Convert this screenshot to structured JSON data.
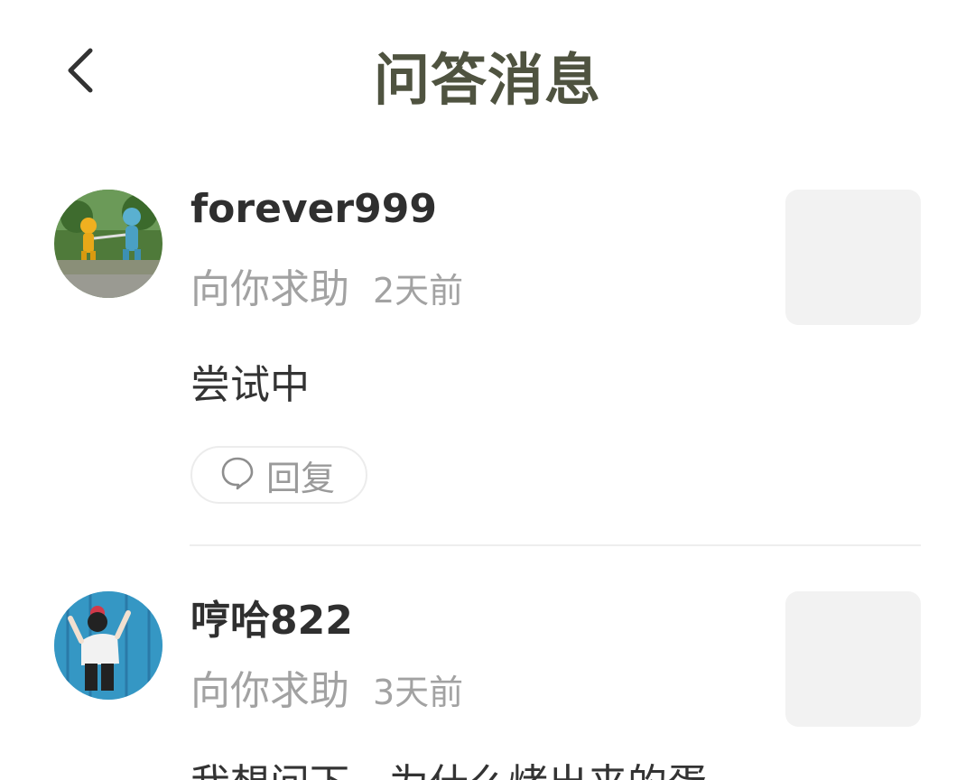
{
  "header": {
    "title": "问答消息",
    "back_icon": "chevron-left-icon"
  },
  "messages": [
    {
      "username": "forever999",
      "action": "向你求助",
      "time": "2天前",
      "content": "尝试中",
      "reply_label": "回复",
      "reply_icon": "speech-bubble-icon"
    },
    {
      "username": "哼哈822",
      "action": "向你求助",
      "time": "3天前",
      "content": "我想问下，为什么烤出来的蛋"
    }
  ],
  "colors": {
    "title": "#4f5340",
    "username": "#2f2f2f",
    "meta": "#a2a2a2",
    "thumb_placeholder": "#f2f2f2",
    "divider": "#eeeeee"
  }
}
